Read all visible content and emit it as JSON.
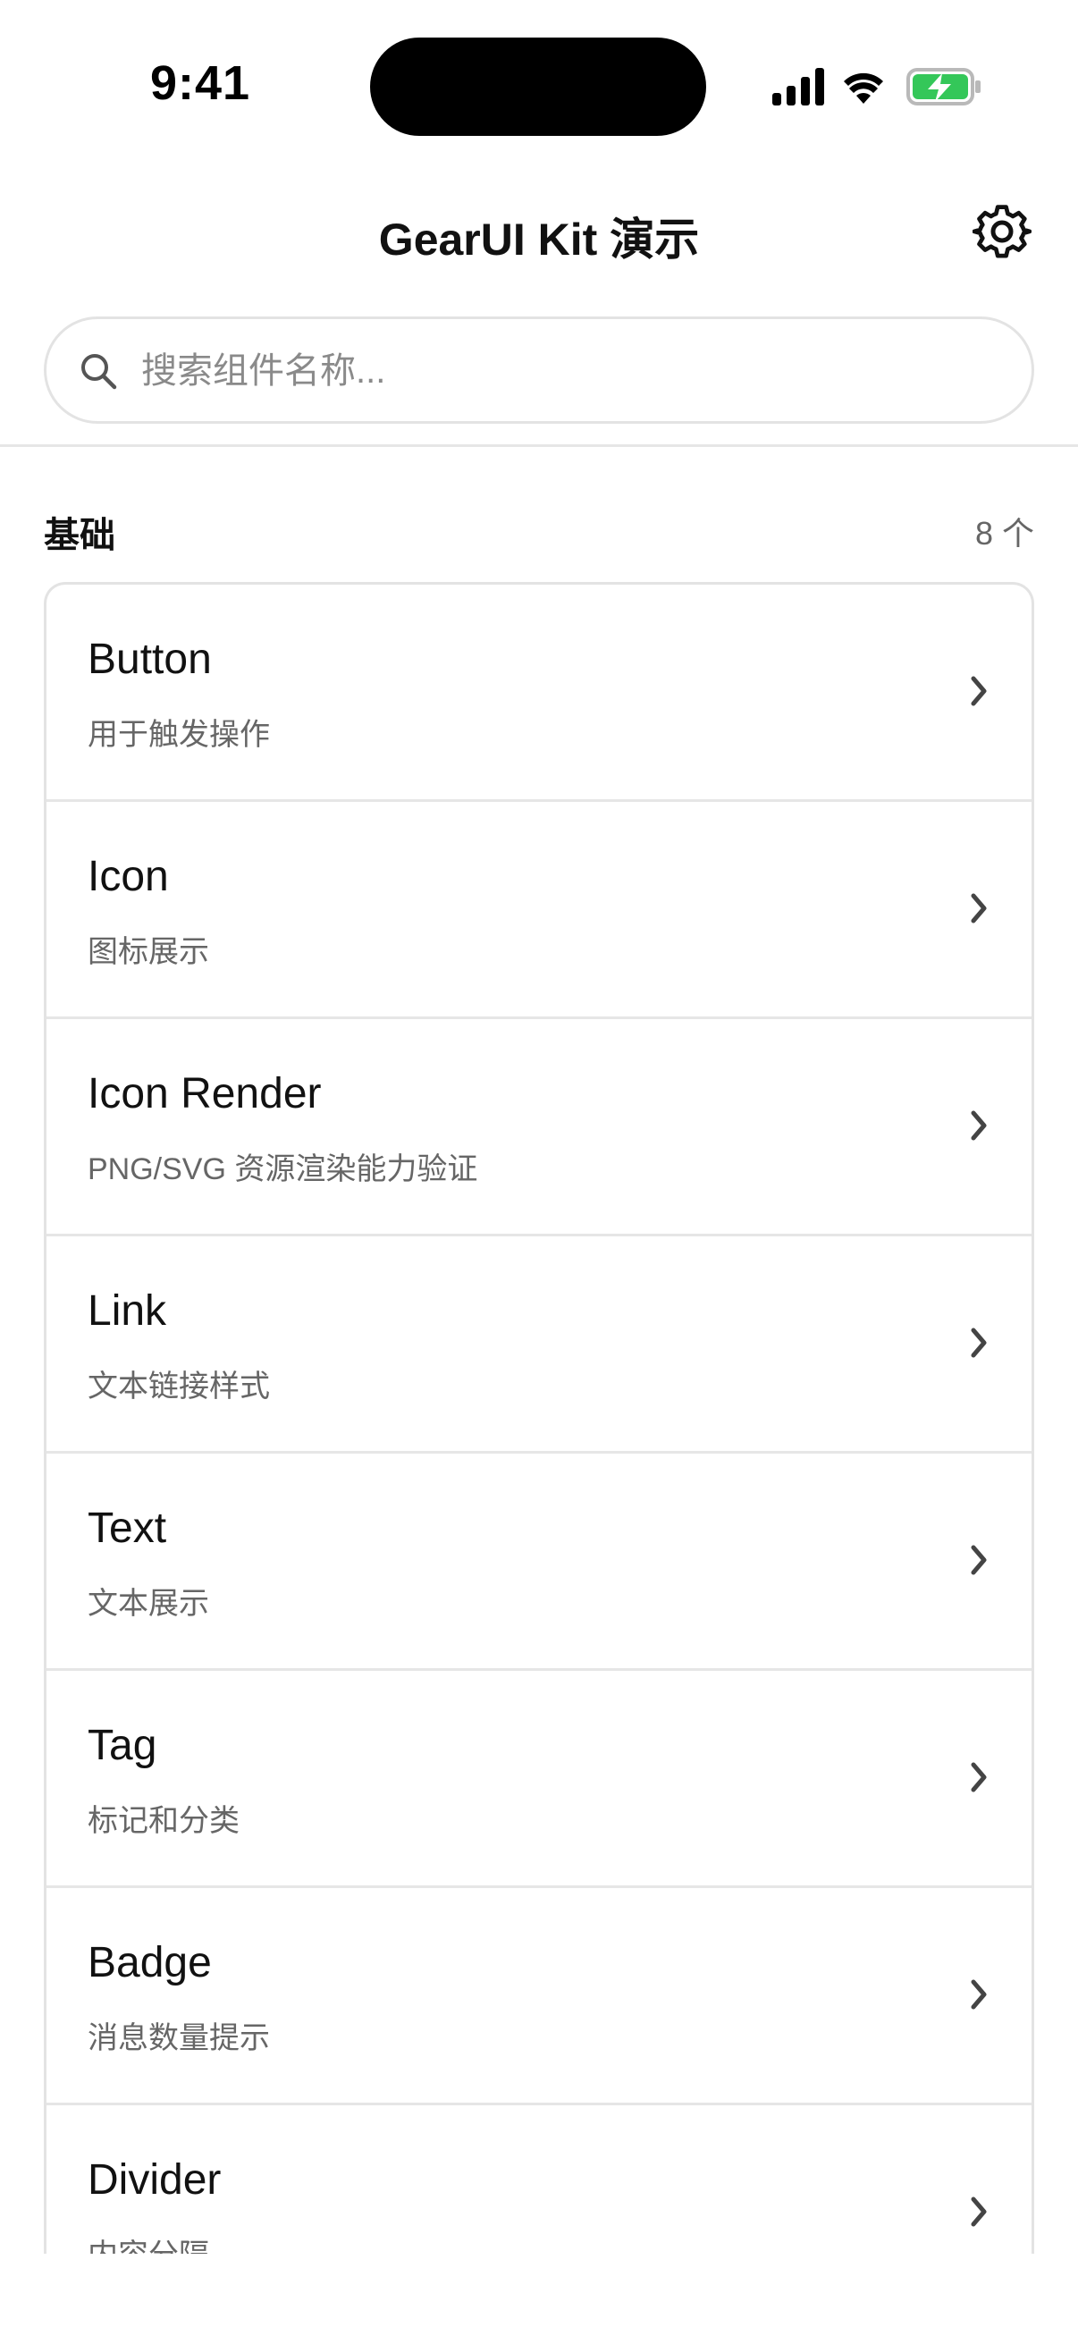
{
  "status_bar": {
    "time": "9:41"
  },
  "nav": {
    "title": "GearUI Kit 演示",
    "settings_icon": "gear-icon"
  },
  "search": {
    "placeholder": "搜索组件名称..."
  },
  "section": {
    "title": "基础",
    "count": "8 个"
  },
  "items": [
    {
      "title": "Button",
      "desc": "用于触发操作"
    },
    {
      "title": "Icon",
      "desc": "图标展示"
    },
    {
      "title": "Icon Render",
      "desc": "PNG/SVG 资源渲染能力验证"
    },
    {
      "title": "Link",
      "desc": "文本链接样式"
    },
    {
      "title": "Text",
      "desc": "文本展示"
    },
    {
      "title": "Tag",
      "desc": "标记和分类"
    },
    {
      "title": "Badge",
      "desc": "消息数量提示"
    },
    {
      "title": "Divider",
      "desc": "内容分隔"
    }
  ],
  "colors": {
    "battery_fill": "#34c759",
    "border": "#e3e3e3",
    "muted_text": "#666666"
  }
}
